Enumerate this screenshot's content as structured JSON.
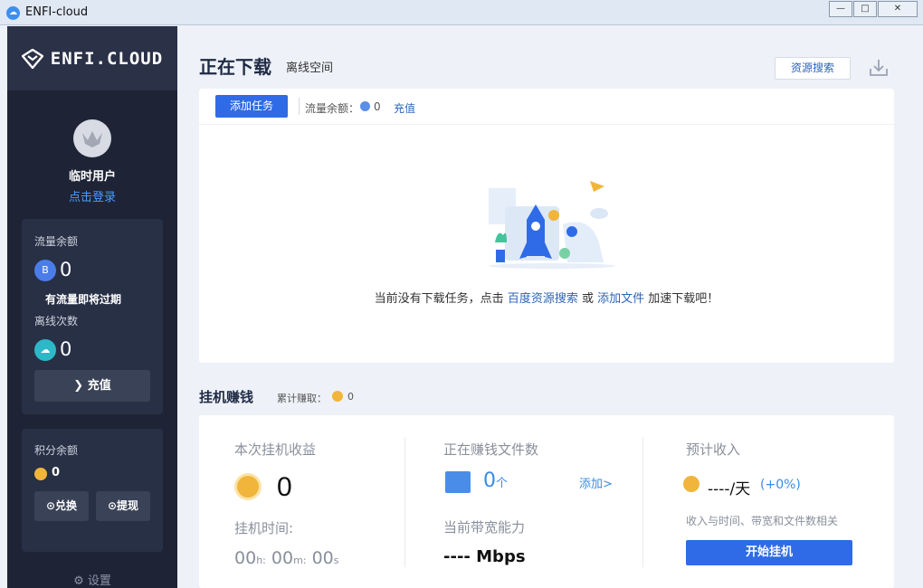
{
  "window": {
    "title": "ENFI-cloud",
    "min": "—",
    "max": "□",
    "close": "✕"
  },
  "sidebar": {
    "brand": "ENFI.CLOUD",
    "user_name": "临时用户",
    "login_link": "点击登录",
    "traffic": {
      "label": "流量余额",
      "value": "0",
      "note": "有流量即将过期"
    },
    "offline": {
      "label": "离线次数",
      "value": "0"
    },
    "recharge_label": "充值",
    "points": {
      "label": "积分余额",
      "value": "0"
    },
    "exchange_label": "兑换",
    "withdraw_label": "提现",
    "settings_label": "设置"
  },
  "header": {
    "title": "正在下载",
    "subtitle": "离线空间",
    "resource_search": "资源搜索"
  },
  "download_panel": {
    "add_task": "添加任务",
    "flow_label": "流量余额：",
    "flow_value": "0",
    "recharge_link": "充值",
    "empty_prefix": "当前没有下载任务，点击",
    "empty_link1": "百度资源搜索",
    "empty_mid": "或",
    "empty_link2": "添加文件",
    "empty_suffix": "加速下载吧！"
  },
  "earn_section": {
    "title": "挂机赚钱",
    "earned_label": "累计赚取：",
    "earned_value": "0"
  },
  "earn_panel": {
    "session_label": "本次挂机收益",
    "session_value": "0",
    "time_label": "挂机时间:",
    "time_h": "00",
    "time_h_unit": "h:",
    "time_m": "00",
    "time_m_unit": "m:",
    "time_s": "00",
    "time_s_unit": "s",
    "files_label": "正在赚钱文件数",
    "files_value": "0",
    "files_unit": "个",
    "add_link": "添加>",
    "bandwidth_label": "当前带宽能力",
    "bandwidth_value": "---- Mbps",
    "estimate_label": "预计收入",
    "estimate_value": "----/天",
    "estimate_pct": "(+0%)",
    "estimate_note": "收入与时间、带宽和文件数相关",
    "start_button": "开始挂机"
  },
  "colors": {
    "accent": "#2f6be6",
    "sidebar": "#1e2436",
    "coin": "#f0b53a"
  }
}
